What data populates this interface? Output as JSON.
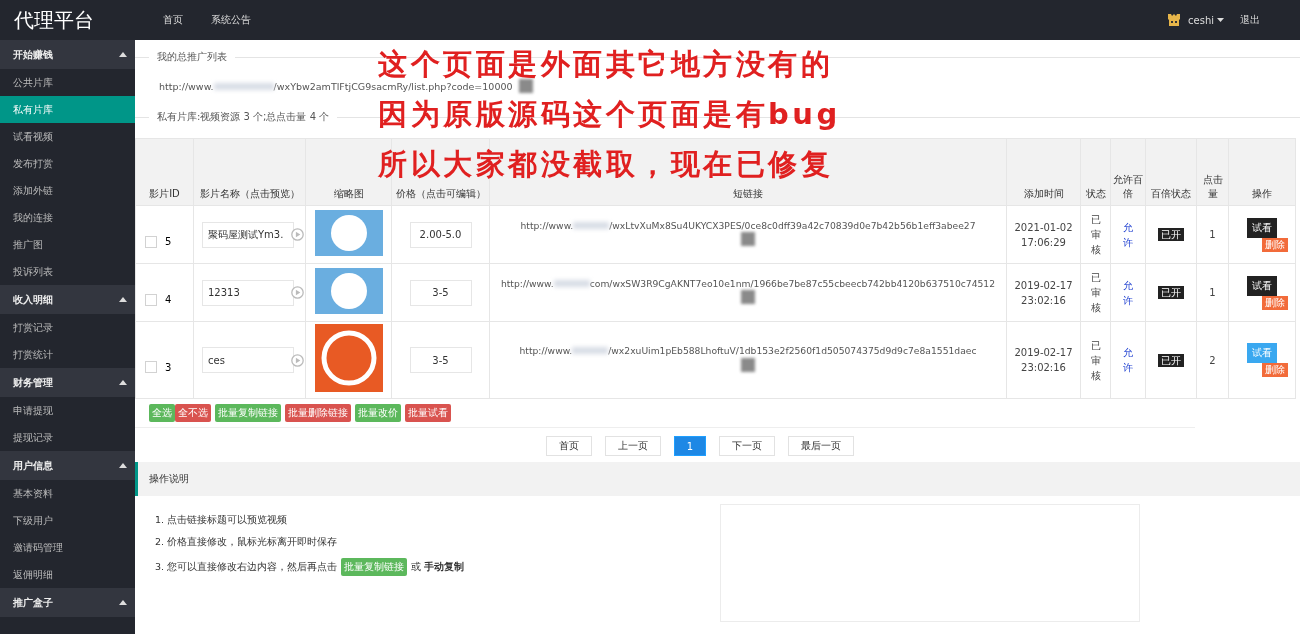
{
  "header": {
    "brand": "代理平台",
    "nav": [
      {
        "label": "首页"
      },
      {
        "label": "系统公告"
      }
    ],
    "user": "ceshi",
    "logout": "退出"
  },
  "sidebar": [
    {
      "title": "开始赚钱",
      "expanded": true,
      "items": [
        {
          "label": "公共片库",
          "selected": false
        },
        {
          "label": "私有片库",
          "selected": true
        },
        {
          "label": "试看视频",
          "selected": false
        },
        {
          "label": "发布打赏",
          "selected": false
        },
        {
          "label": "添加外链",
          "selected": false
        },
        {
          "label": "我的连接",
          "selected": false
        },
        {
          "label": "推广图",
          "selected": false
        },
        {
          "label": "投诉列表",
          "selected": false
        }
      ]
    },
    {
      "title": "收入明细",
      "expanded": true,
      "items": [
        {
          "label": "打赏记录",
          "selected": false
        },
        {
          "label": "打赏统计",
          "selected": false
        }
      ]
    },
    {
      "title": "财务管理",
      "expanded": true,
      "items": [
        {
          "label": "申请提现",
          "selected": false
        },
        {
          "label": "提现记录",
          "selected": false
        }
      ]
    },
    {
      "title": "用户信息",
      "expanded": true,
      "items": [
        {
          "label": "基本资料",
          "selected": false
        },
        {
          "label": "下级用户",
          "selected": false
        },
        {
          "label": "邀请码管理",
          "selected": false
        },
        {
          "label": "返佣明细",
          "selected": false
        }
      ]
    },
    {
      "title": "推广盒子",
      "expanded": true
    }
  ],
  "promo": {
    "title": "我的总推广列表",
    "url_prefix": "http://www.",
    "url_path": "/wxYbw2amTlFtjCG9sacmRy/list.php?code=10000",
    "stats": "私有片库:视频资源 3 个;总点击量 4 个"
  },
  "annotation": [
    "这个页面是外面其它地方没有的",
    "因为原版源码这个页面是有bug",
    "所以大家都没截取，现在已修复"
  ],
  "table": {
    "columns": [
      "影片ID",
      "影片名称（点击预览）",
      "缩略图",
      "价格（点击可编辑）",
      "短链接",
      "添加时间",
      "状态",
      "允许百倍",
      "百倍状态",
      "点击量",
      "操作"
    ],
    "rows": [
      {
        "checked": false,
        "id": "5",
        "name": "聚码屋测试Ym3.",
        "thumbnail": {
          "kind": "circle"
        },
        "price": "2.00-5.0",
        "link_prefix": "http://www.",
        "link_path": "/wxLtvXuMx8Su4UKYCX3PES/0ce8c0dff39a42c70839d0e7b42b56b1eff3abee27",
        "added": "2021-01-02 17:06:29",
        "status": "已审核",
        "allow": "允许",
        "hundred": "已开",
        "clicks": "1",
        "preview": {
          "label": "试看",
          "color": "#222222"
        },
        "delete": "删除"
      },
      {
        "checked": false,
        "id": "4",
        "name": "12313",
        "thumbnail": {
          "kind": "circle"
        },
        "price": "3-5",
        "link_prefix": "http://www.",
        "link_path": "com/wxSW3R9CgAKNT7eo10e1nm/1966be7be87c55cbeecb742bb4120b637510c74512",
        "added": "2019-02-17 23:02:16",
        "status": "已审核",
        "allow": "允许",
        "hundred": "已开",
        "clicks": "1",
        "preview": {
          "label": "试看",
          "color": "#222222"
        },
        "delete": "删除"
      },
      {
        "checked": false,
        "id": "3",
        "name": "ces",
        "thumbnail": {
          "kind": "ring"
        },
        "price": "3-5",
        "link_prefix": "http://www.",
        "link_path": "/wx2xuUim1pEb588LhoftuV/1db153e2f2560f1d505074375d9d9c7e8a1551daec",
        "added": "2019-02-17 23:02:16",
        "status": "已审核",
        "allow": "允许",
        "hundred": "已开",
        "clicks": "2",
        "preview": {
          "label": "试看",
          "color": "#3aa8f0"
        },
        "delete": "删除"
      }
    ]
  },
  "batch": [
    {
      "label": "全选",
      "color": "#5cb85c"
    },
    {
      "label": "全不选",
      "color": "#d9534f"
    },
    {
      "label": "批量复制链接",
      "color": "#5cb85c"
    },
    {
      "label": "批量删除链接",
      "color": "#d9534f"
    },
    {
      "label": "批量改价",
      "color": "#5cb85c"
    },
    {
      "label": "批量试看",
      "color": "#d9534f"
    }
  ],
  "pagination": [
    {
      "label": "首页",
      "selected": false
    },
    {
      "label": "上一页",
      "selected": false
    },
    {
      "label": "1",
      "selected": true
    },
    {
      "label": "下一页",
      "selected": false
    },
    {
      "label": "最后一页",
      "selected": false
    }
  ],
  "instructions": {
    "title": "操作说明",
    "items": [
      {
        "text": "1. 点击链接标题可以预览视频"
      },
      {
        "text": "2. 价格直接修改，鼠标光标离开即时保存"
      },
      {
        "text": "3. 您可以直接修改右边内容，然后再点击",
        "button": "批量复制链接",
        "after": "或 **手动复制**"
      }
    ]
  }
}
